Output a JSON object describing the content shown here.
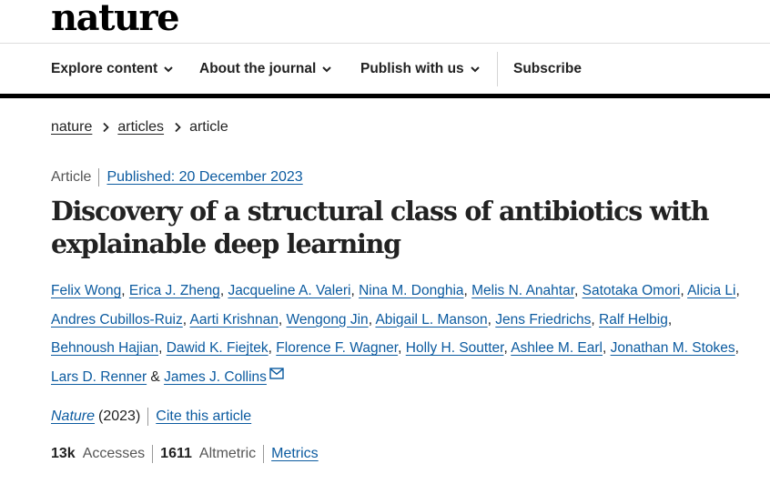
{
  "brand": {
    "logo": "nature"
  },
  "nav": {
    "items": [
      {
        "label": "Explore content",
        "has_dropdown": true
      },
      {
        "label": "About the journal",
        "has_dropdown": true
      },
      {
        "label": "Publish with us",
        "has_dropdown": true
      }
    ],
    "subscribe": "Subscribe"
  },
  "breadcrumb": [
    "nature",
    "articles",
    "article"
  ],
  "article": {
    "type": "Article",
    "published": "Published: 20 December 2023",
    "title_line1": "Discovery of a structural class of antibiotics with",
    "title_line2": "explainable deep learning",
    "authors": [
      "Felix Wong",
      "Erica J. Zheng",
      "Jacqueline A. Valeri",
      "Nina M. Donghia",
      "Melis N. Anahtar",
      "Satotaka Omori",
      "Alicia Li",
      "Andres Cubillos-Ruiz",
      "Aarti Krishnan",
      "Wengong Jin",
      "Abigail L. Manson",
      "Jens Friedrichs",
      "Ralf Helbig",
      "Behnoush Hajian",
      "Dawid K. Fiejtek",
      "Florence F. Wagner",
      "Holly H. Soutter",
      "Ashlee M. Earl",
      "Jonathan M. Stokes",
      "Lars D. Renner",
      "James J. Collins"
    ],
    "author_separator": ",",
    "author_last_joiner": "&",
    "journal": "Nature",
    "year": "(2023)",
    "cite": "Cite this article",
    "metrics": {
      "accesses_value": "13k",
      "accesses_label": "Accesses",
      "altmetric_value": "1611",
      "altmetric_label": "Altmetric",
      "metrics_link": "Metrics"
    }
  },
  "colors": {
    "link": "#0c5ba0",
    "text": "#222222",
    "rule": "#000000"
  },
  "icons": {
    "dropdown": "chevron-down-icon",
    "breadcrumb_separator": "chevron-right-icon",
    "corresponding_author": "mail-icon"
  }
}
